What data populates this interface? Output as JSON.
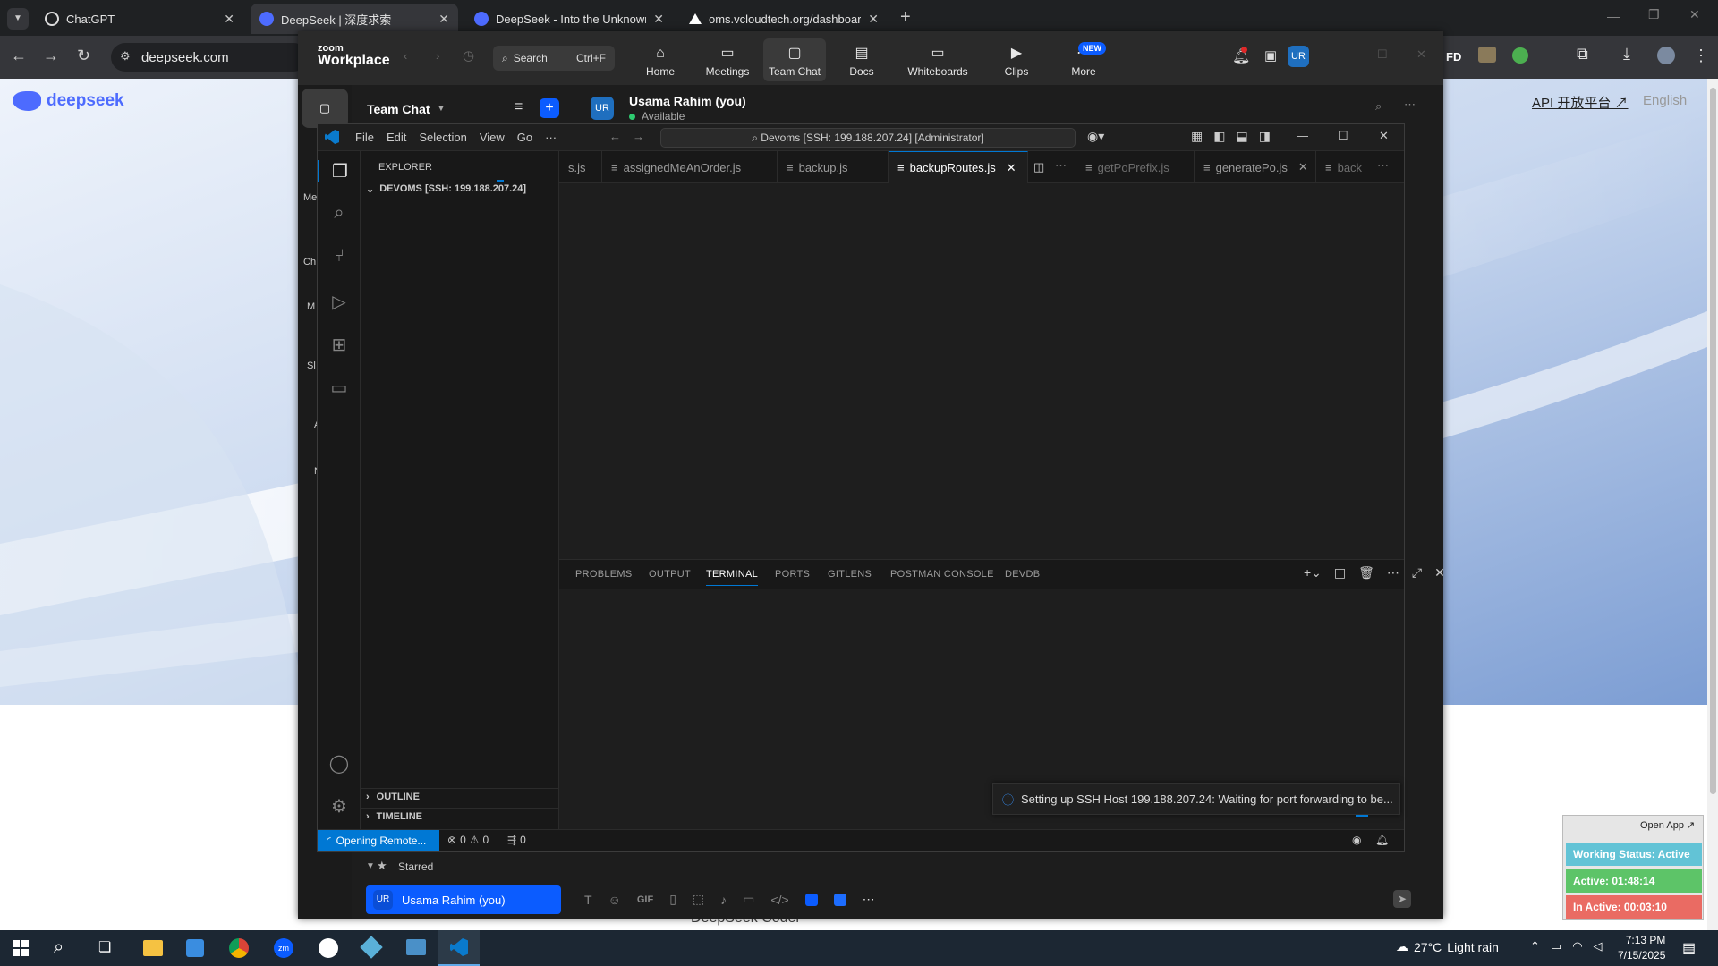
{
  "browser": {
    "tabs": [
      {
        "title": "ChatGPT",
        "active": false
      },
      {
        "title": "DeepSeek | 深度求索",
        "active": true
      },
      {
        "title": "DeepSeek - Into the Unknown",
        "active": false
      },
      {
        "title": "oms.vcloudtech.org/dashboard",
        "active": false
      }
    ],
    "new_tab": "+",
    "url": "deepseek.com"
  },
  "deepseek": {
    "logo_text": "deepseek",
    "api_link": "API 开放平台 ↗",
    "language": "English",
    "footer_text": "DeepSeek Coder"
  },
  "zoom": {
    "logo_line1": "zoom",
    "logo_line2": "Workplace",
    "search_label": "Search",
    "search_shortcut": "Ctrl+F",
    "nav": [
      {
        "label": "Home",
        "icon": "home-icon",
        "glyph": "⌂"
      },
      {
        "label": "Meetings",
        "icon": "video-icon",
        "glyph": "▭"
      },
      {
        "label": "Team Chat",
        "icon": "chat-icon",
        "glyph": "▢"
      },
      {
        "label": "Docs",
        "icon": "docs-icon",
        "glyph": "▤"
      },
      {
        "label": "Whiteboards",
        "icon": "whiteboard-icon",
        "glyph": "▭"
      },
      {
        "label": "Clips",
        "icon": "clips-icon",
        "glyph": "▶"
      },
      {
        "label": "More",
        "icon": "more-icon",
        "glyph": "⋯"
      }
    ],
    "new_badge": "NEW",
    "avatar_initials": "UR",
    "team_chat_title": "Team Chat",
    "chat_user_name": "Usama Rahim (you)",
    "chat_user_status": "Available",
    "sidebar_letters": [
      "Me",
      "Ch",
      "M",
      "Sl",
      "A",
      "N"
    ],
    "starred_label": "Starred",
    "starred_user": "Usama Rahim (you)",
    "composer_gif": "GIF"
  },
  "vscode": {
    "menu": [
      "File",
      "Edit",
      "Selection",
      "View",
      "Go",
      "···"
    ],
    "command_center": "Devoms [SSH: 199.188.207.24] [Administrator]",
    "explorer_title": "EXPLORER",
    "workspace": "DEVOMS [SSH: 199.188.207.24]",
    "outline": "OUTLINE",
    "timeline": "TIMELINE",
    "tabs_left": [
      {
        "name": "s.js",
        "active": false
      },
      {
        "name": "assignedMeAnOrder.js",
        "active": false
      },
      {
        "name": "backup.js",
        "active": false
      },
      {
        "name": "backupRoutes.js",
        "active": true
      }
    ],
    "tabs_right": [
      {
        "name": "getPoPrefix.js",
        "active": false
      },
      {
        "name": "generatePo.js",
        "active": false
      },
      {
        "name": "back",
        "active": false
      }
    ],
    "panel_tabs": [
      "PROBLEMS",
      "OUTPUT",
      "TERMINAL",
      "PORTS",
      "GITLENS",
      "POSTMAN CONSOLE",
      "DEVDB"
    ],
    "active_panel_tab": "TERMINAL",
    "notification": "Setting up SSH Host 199.188.207.24: Waiting for port forwarding to be...",
    "status_remote": "Opening Remote...",
    "status_errors": "0",
    "status_warnings": "0",
    "status_ports": "0"
  },
  "widget": {
    "open_app": "Open App ↗",
    "working_status": "Working Status: Active",
    "active_time": "Active: 01:48:14",
    "inactive_time": "In Active: 00:03:10",
    "colors": {
      "status": "#62c3d6",
      "active": "#5dc468",
      "inactive": "#ea6b63"
    }
  },
  "taskbar": {
    "weather_temp": "27°C",
    "weather_desc": "Light rain",
    "time": "7:13 PM",
    "date": "7/15/2025"
  },
  "colors": {
    "accent": "#0078d4",
    "deepseek_blue": "#4d6bfe",
    "zoom_blue": "#0b5cff"
  }
}
